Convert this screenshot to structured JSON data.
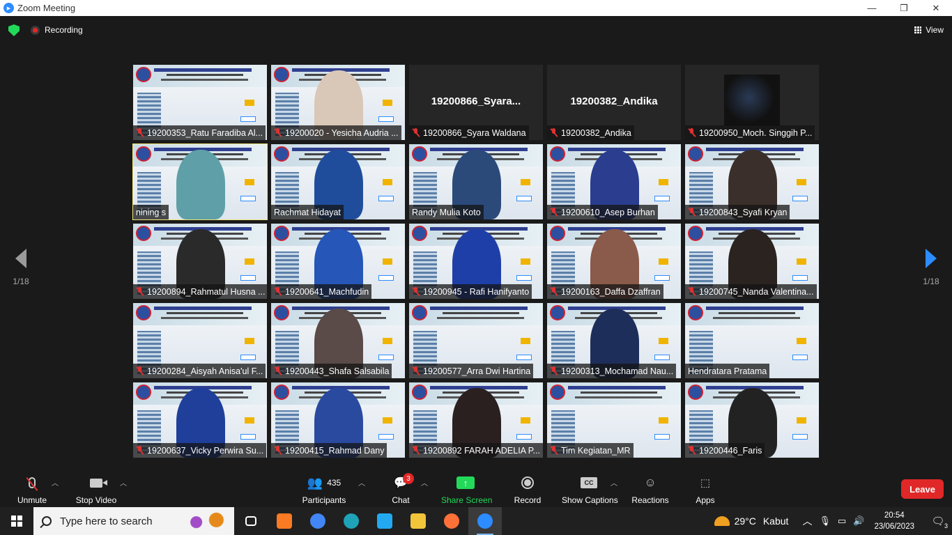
{
  "window": {
    "title": "Zoom Meeting",
    "controls": [
      "—",
      "❐",
      "✕"
    ]
  },
  "topbar": {
    "recording_label": "Recording",
    "view_label": "View"
  },
  "pager": {
    "left_label": "1/18",
    "right_label": "1/18"
  },
  "participants": [
    {
      "name": "19200353_Ratu Faradiba Al...",
      "kind": "slide"
    },
    {
      "name": "19200020 - Yesicha Audria ...",
      "kind": "slide-person",
      "person_color": "#d9c7b8"
    },
    {
      "name": "19200866_Syara Waldana",
      "kind": "blank",
      "initial": "19200866_Syara..."
    },
    {
      "name": "19200382_Andika",
      "kind": "blank",
      "initial": "19200382_Andika"
    },
    {
      "name": "19200950_Moch. Singgih P...",
      "kind": "thumb"
    },
    {
      "name": "nining s",
      "kind": "slide-person",
      "person_color": "#5fa0a8",
      "active": true
    },
    {
      "name": "Rachmat Hidayat",
      "kind": "slide-person",
      "person_color": "#1f4d9c"
    },
    {
      "name": "Randy Mulia Koto",
      "kind": "slide-person",
      "person_color": "#2b4a7a"
    },
    {
      "name": "19200610_Asep Burhan",
      "kind": "slide-person",
      "person_color": "#2a3d8f"
    },
    {
      "name": "19200843_Syafi Kryan",
      "kind": "slide-person",
      "person_color": "#3a2f2a"
    },
    {
      "name": "19200894_Rahmatul Husna ...",
      "kind": "slide-person",
      "person_color": "#2a2a2a"
    },
    {
      "name": "19200641_Machfudin",
      "kind": "slide-person",
      "person_color": "#2556b8"
    },
    {
      "name": "19200945 - Rafi Hanifyanto",
      "kind": "slide-person",
      "person_color": "#1f3fa8"
    },
    {
      "name": "19200163_Daffa Dzaffran",
      "kind": "slide-person",
      "person_color": "#8a5a4a"
    },
    {
      "name": "19200745_Nanda Valentina...",
      "kind": "slide-person",
      "person_color": "#2a2320"
    },
    {
      "name": "19200284_Aisyah Anisa'ul F...",
      "kind": "slide"
    },
    {
      "name": "19200443_Shafa Salsabila",
      "kind": "slide-person",
      "person_color": "#5a4a48"
    },
    {
      "name": "19200577_Arra Dwi Hartina",
      "kind": "slide"
    },
    {
      "name": "19200313_Mochamad Nau...",
      "kind": "slide-person",
      "person_color": "#1e2e5a"
    },
    {
      "name": "Hendratara Pratama",
      "kind": "slide"
    },
    {
      "name": "19200637_Vicky Perwira Su...",
      "kind": "slide-person",
      "person_color": "#1f3f9a"
    },
    {
      "name": "19200415_Rahmad Dany",
      "kind": "slide-person",
      "person_color": "#2a4aa0"
    },
    {
      "name": "19200892 FARAH ADELIA P...",
      "kind": "slide-person",
      "person_color": "#2a2020"
    },
    {
      "name": "Tim Kegiatan_MR",
      "kind": "slide"
    },
    {
      "name": "19200446_Faris",
      "kind": "slide-person",
      "person_color": "#222222"
    }
  ],
  "toolbar": {
    "unmute": "Unmute",
    "stop_video": "Stop Video",
    "participants_label": "Participants",
    "participants_count": "435",
    "chat": "Chat",
    "chat_badge": "3",
    "share_screen": "Share Screen",
    "record": "Record",
    "show_captions": "Show Captions",
    "cc_icon_text": "CC",
    "reactions": "Reactions",
    "apps": "Apps",
    "leave": "Leave"
  },
  "taskbar": {
    "search_placeholder": "Type here to search",
    "weather_temp": "29°C",
    "weather_desc": "Kabut",
    "time": "20:54",
    "date": "23/06/2023",
    "notification_count": "3",
    "apps": [
      {
        "name": "task-view",
        "color": "#ffffff"
      },
      {
        "name": "xampp",
        "color": "#fb7a24"
      },
      {
        "name": "chrome",
        "color": "#4285f4"
      },
      {
        "name": "edge",
        "color": "#1fa3b8"
      },
      {
        "name": "vscode",
        "color": "#23a9f2"
      },
      {
        "name": "file-explorer",
        "color": "#f2c43a"
      },
      {
        "name": "firefox",
        "color": "#ff7139"
      },
      {
        "name": "zoom",
        "color": "#2d8cff"
      }
    ]
  },
  "colors": {
    "accent": "#2d8cff",
    "leave": "#e02828",
    "share": "#23d959",
    "active_speaker": "#f1e678",
    "muted": "#e03131"
  }
}
